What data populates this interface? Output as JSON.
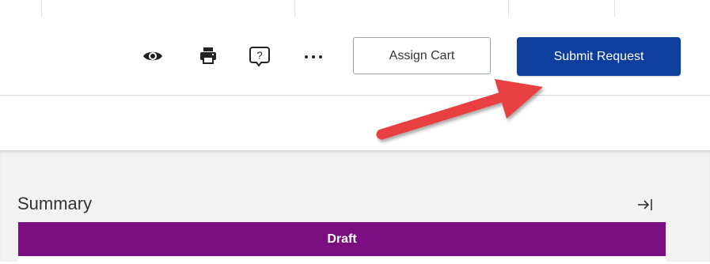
{
  "toolbar": {
    "preview_icon": "eye-icon",
    "print_icon": "printer-icon",
    "help_icon": "help-icon",
    "more_icon": "more-horizontal-icon",
    "assign_cart_label": "Assign Cart",
    "submit_request_label": "Submit Request"
  },
  "summary": {
    "title": "Summary",
    "collapse_icon": "collapse-right-icon",
    "status": "Draft"
  },
  "colors": {
    "primary_button": "#0f3f9e",
    "status_banner": "#7a0d7f",
    "annotation_arrow": "#e8413f"
  }
}
